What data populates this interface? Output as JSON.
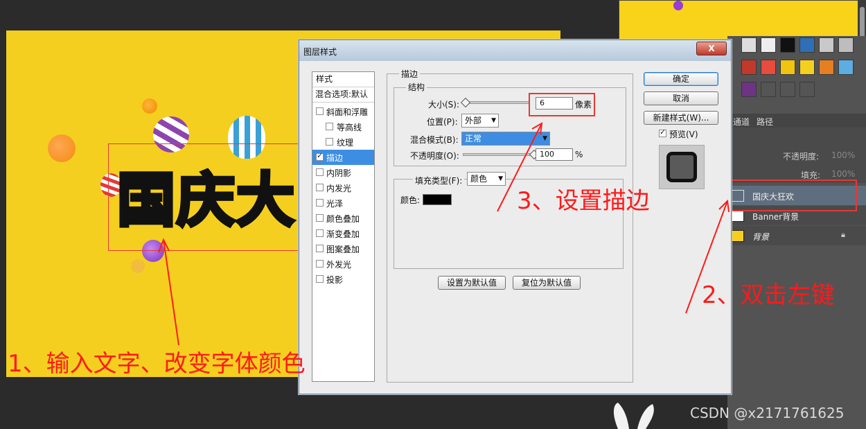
{
  "canvas": {
    "headline": "国庆大",
    "background_color": "#f4cf1f"
  },
  "dialog": {
    "title": "图层样式",
    "close_label": "X",
    "styles_header": "样式",
    "blend_options": "混合选项:默认",
    "styles": [
      {
        "label": "斜面和浮雕",
        "checked": false
      },
      {
        "label": "等高线",
        "checked": false
      },
      {
        "label": "纹理",
        "checked": false
      },
      {
        "label": "描边",
        "checked": true,
        "selected": true
      },
      {
        "label": "内阴影",
        "checked": false
      },
      {
        "label": "内发光",
        "checked": false
      },
      {
        "label": "光泽",
        "checked": false
      },
      {
        "label": "颜色叠加",
        "checked": false
      },
      {
        "label": "渐变叠加",
        "checked": false
      },
      {
        "label": "图案叠加",
        "checked": false
      },
      {
        "label": "外发光",
        "checked": false
      },
      {
        "label": "投影",
        "checked": false
      }
    ],
    "stroke": {
      "group_title": "描边",
      "structure_title": "结构",
      "size_label": "大小(S):",
      "size_value": "6",
      "size_unit": "像素",
      "size_slider_fraction": 0.02,
      "position_label": "位置(P):",
      "position_value": "外部",
      "blend_label": "混合模式(B):",
      "blend_value": "正常",
      "opacity_label": "不透明度(O):",
      "opacity_value": "100",
      "opacity_unit": "%",
      "opacity_slider_fraction": 1.0,
      "fill_type_label": "填充类型(F):",
      "fill_type_value": "颜色",
      "color_label": "颜色:",
      "color_value": "#000000",
      "set_default": "设置为默认值",
      "reset_default": "复位为默认值"
    },
    "buttons": {
      "ok": "确定",
      "cancel": "取消",
      "new_style": "新建样式(W)...",
      "preview_label": "预览(V)",
      "preview_checked": true
    }
  },
  "layers_panel": {
    "tabs": [
      "通道",
      "路径"
    ],
    "opacity_label": "不透明度:",
    "opacity_value": "100%",
    "fill_label": "填充:",
    "fill_value": "100%",
    "layers": [
      {
        "name": "国庆大狂欢",
        "selected": true
      },
      {
        "name": "Banner背景",
        "selected": false
      },
      {
        "name": "背景",
        "selected": false,
        "locked": true
      }
    ]
  },
  "annotations": {
    "step1": "1、输入文字、改变字体颜色",
    "step2": "2、双击左键",
    "step3": "3、设置描边",
    "color": "#ff1a1a"
  },
  "watermark": "CSDN @x2171761625"
}
